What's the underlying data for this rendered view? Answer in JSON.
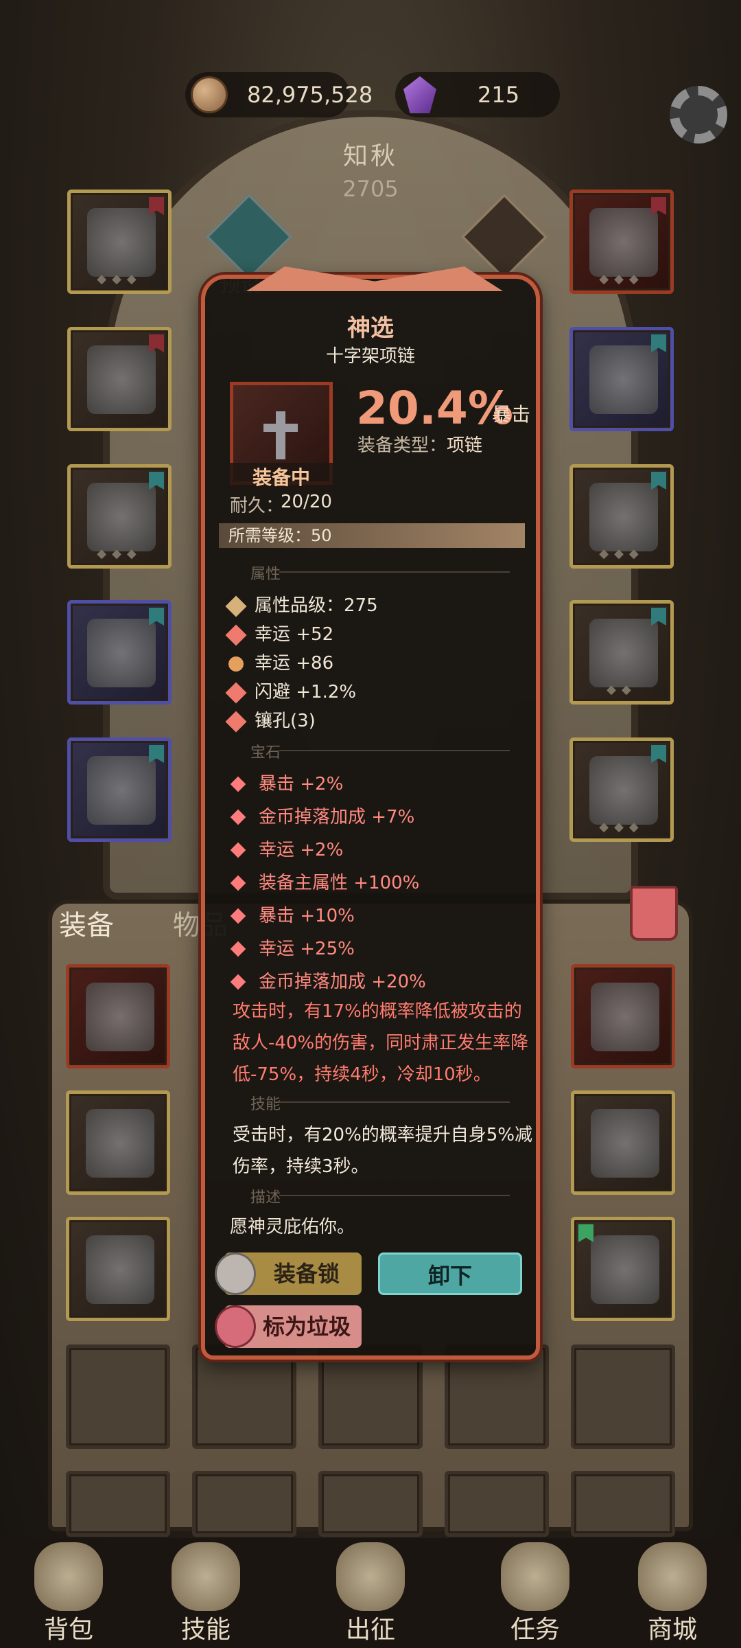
{
  "currency": {
    "gold": "82,975,528",
    "gems": "215"
  },
  "hero": {
    "name": "知秋",
    "power": "2705",
    "preset_label": "预设一"
  },
  "tabs": {
    "equipment": "装备",
    "items": "物品"
  },
  "tooltip": {
    "title": "神选",
    "item_name": "十字架项链",
    "equipped_label": "装备中",
    "main_value": "20.4%",
    "main_value_label": "暴击",
    "type_label": "装备类型：",
    "type_value": "项链",
    "durability_label": "耐久：",
    "durability_value": "20/20",
    "required_level": "所需等级：50",
    "sections": {
      "attributes": "属性",
      "gems": "宝石",
      "skills": "技能",
      "description": "描述"
    },
    "attributes": [
      "属性品级：275",
      "幸运 +52",
      "幸运 +86",
      "闪避 +1.2%",
      "镶孔(3)"
    ],
    "gem_stats": [
      "暴击 +2%",
      "金币掉落加成 +7%",
      "幸运 +2%",
      "装备主属性 +100%",
      "暴击 +10%",
      "幸运 +25%",
      "金币掉落加成 +20%"
    ],
    "gem_effect": "攻击时，有17%的概率降低被攻击的敌人-40%的伤害，同时肃正发生率降低-75%，持续4秒，冷却10秒。",
    "skill_effect": "受击时，有20%的概率提升自身5%减伤率，持续3秒。",
    "description": "愿神灵庇佑你。",
    "buttons": {
      "lock": "装备锁",
      "unequip": "卸下",
      "mark_trash": "标为垃圾"
    }
  },
  "bottom_nav": [
    "背包",
    "技能",
    "出征",
    "任务",
    "商城"
  ]
}
